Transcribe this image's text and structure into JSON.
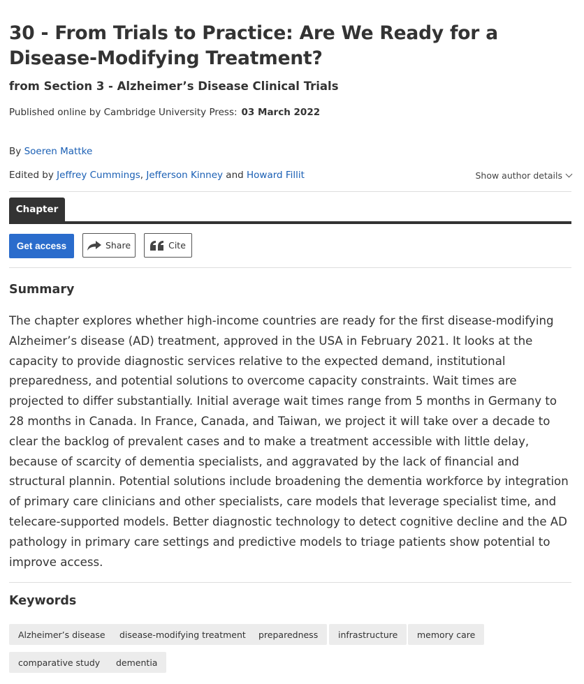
{
  "title": "30 - From Trials to Practice: Are We Ready for a Disease-Modifying Treatment?",
  "section": "from Section 3 - Alzheimer’s Disease Clinical Trials",
  "published": {
    "label": "Published online by Cambridge University Press:",
    "date": "03 March 2022"
  },
  "byline": {
    "prefix": "By",
    "author": "Soeren Mattke"
  },
  "edited": {
    "prefix": "Edited by",
    "editors": [
      "Jeffrey Cummings",
      "Jefferson Kinney",
      "Howard Fillit"
    ],
    "separator": ",",
    "and": "and"
  },
  "show_author_details": "Show author details",
  "tabs": [
    {
      "label": "Chapter"
    }
  ],
  "actions": {
    "get_access": "Get access",
    "share": "Share",
    "cite": "Cite"
  },
  "summary": {
    "heading": "Summary",
    "text": "The chapter explores whether high-income countries are ready for the first disease-modifying Alzheimer’s disease (AD) treatment, approved in the USA in February 2021. It looks at the capacity to provide diagnostic services relative to the expected demand, institutional preparedness, and potential solutions to overcome capacity constraints. Wait times are projected to differ substantially. Initial average wait times range from 5 months in Germany to 28 months in Canada. In France, Canada, and Taiwan, we project it will take over a decade to clear the backlog of prevalent cases and to make a treatment accessible with little delay, because of scarcity of dementia specialists, and aggravated by the lack of financial and structural plannin. Potential solutions include broadening the dementia workforce by integration of primary care clinicians and other specialists, care models that leverage specialist time, and telecare-supported models. Better diagnostic technology to detect cognitive decline and the AD pathology in primary care settings and predictive models to triage patients show potential to improve access."
  },
  "keywords": {
    "heading": "Keywords",
    "items": [
      "Alzheimer’s disease",
      "disease-modifying treatment",
      "preparedness",
      "infrastructure",
      "memory care",
      "comparative study",
      "dementia"
    ]
  },
  "colors": {
    "link": "#1a5fb4",
    "primary_button": "#2a6ccc",
    "tab_active": "#333333",
    "keyword_bg": "#ececec"
  },
  "icons": {
    "share": "share-arrow-icon",
    "cite": "quote-icon",
    "show_details": "chevron-down-icon"
  }
}
